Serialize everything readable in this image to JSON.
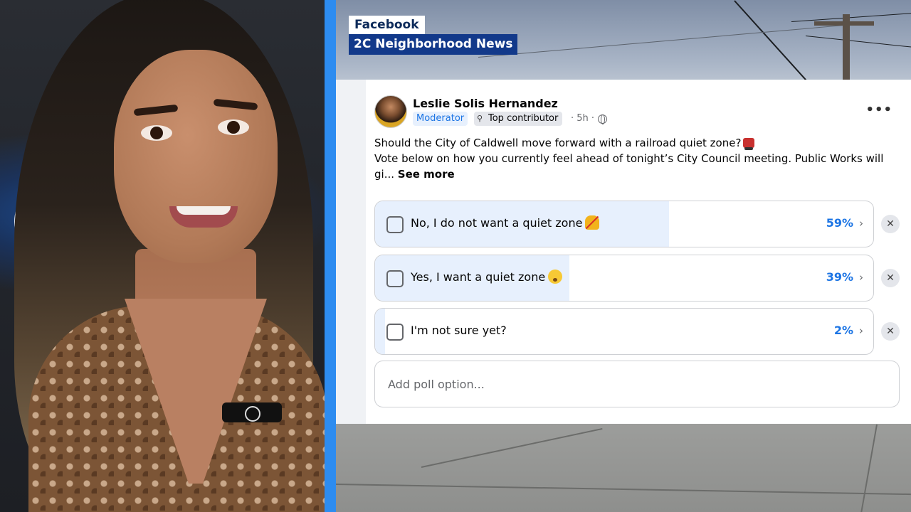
{
  "overlay": {
    "source": "Facebook",
    "group": "2C Neighborhood News"
  },
  "post": {
    "author": "Leslie Solis Hernandez",
    "badges": {
      "moderator": "Moderator",
      "contributor": "Top contributor"
    },
    "time": "· 5h ·",
    "text_line1": "Should the City of Caldwell move forward with a railroad quiet zone?",
    "text_line2": "Vote below on how you currently feel ahead of tonight’s City Council meeting. Public Works will",
    "text_line3": "gi...",
    "see_more": "See more",
    "icons": [
      "train-emoji-icon",
      "globe-icon",
      "more-icon",
      "award-icon"
    ]
  },
  "poll": {
    "options": [
      {
        "label": "No, I do not want a quiet zone",
        "percent_text": "59%",
        "percent": 59,
        "emoji": "no-bell-icon"
      },
      {
        "label": "Yes, I want a quiet zone",
        "percent_text": "39%",
        "percent": 39,
        "emoji": "shushing-face-icon"
      },
      {
        "label": "I'm not sure yet?",
        "percent_text": "2%",
        "percent": 2,
        "emoji": ""
      }
    ],
    "chevron": "›",
    "remove_symbol": "✕",
    "add_option_placeholder": "Add poll option..."
  },
  "colors": {
    "accent_blue": "#1b74e4",
    "poll_fill": "#e7f0fd",
    "divider_blue": "#2d8cf0",
    "group_tag_bg": "#12398a"
  }
}
